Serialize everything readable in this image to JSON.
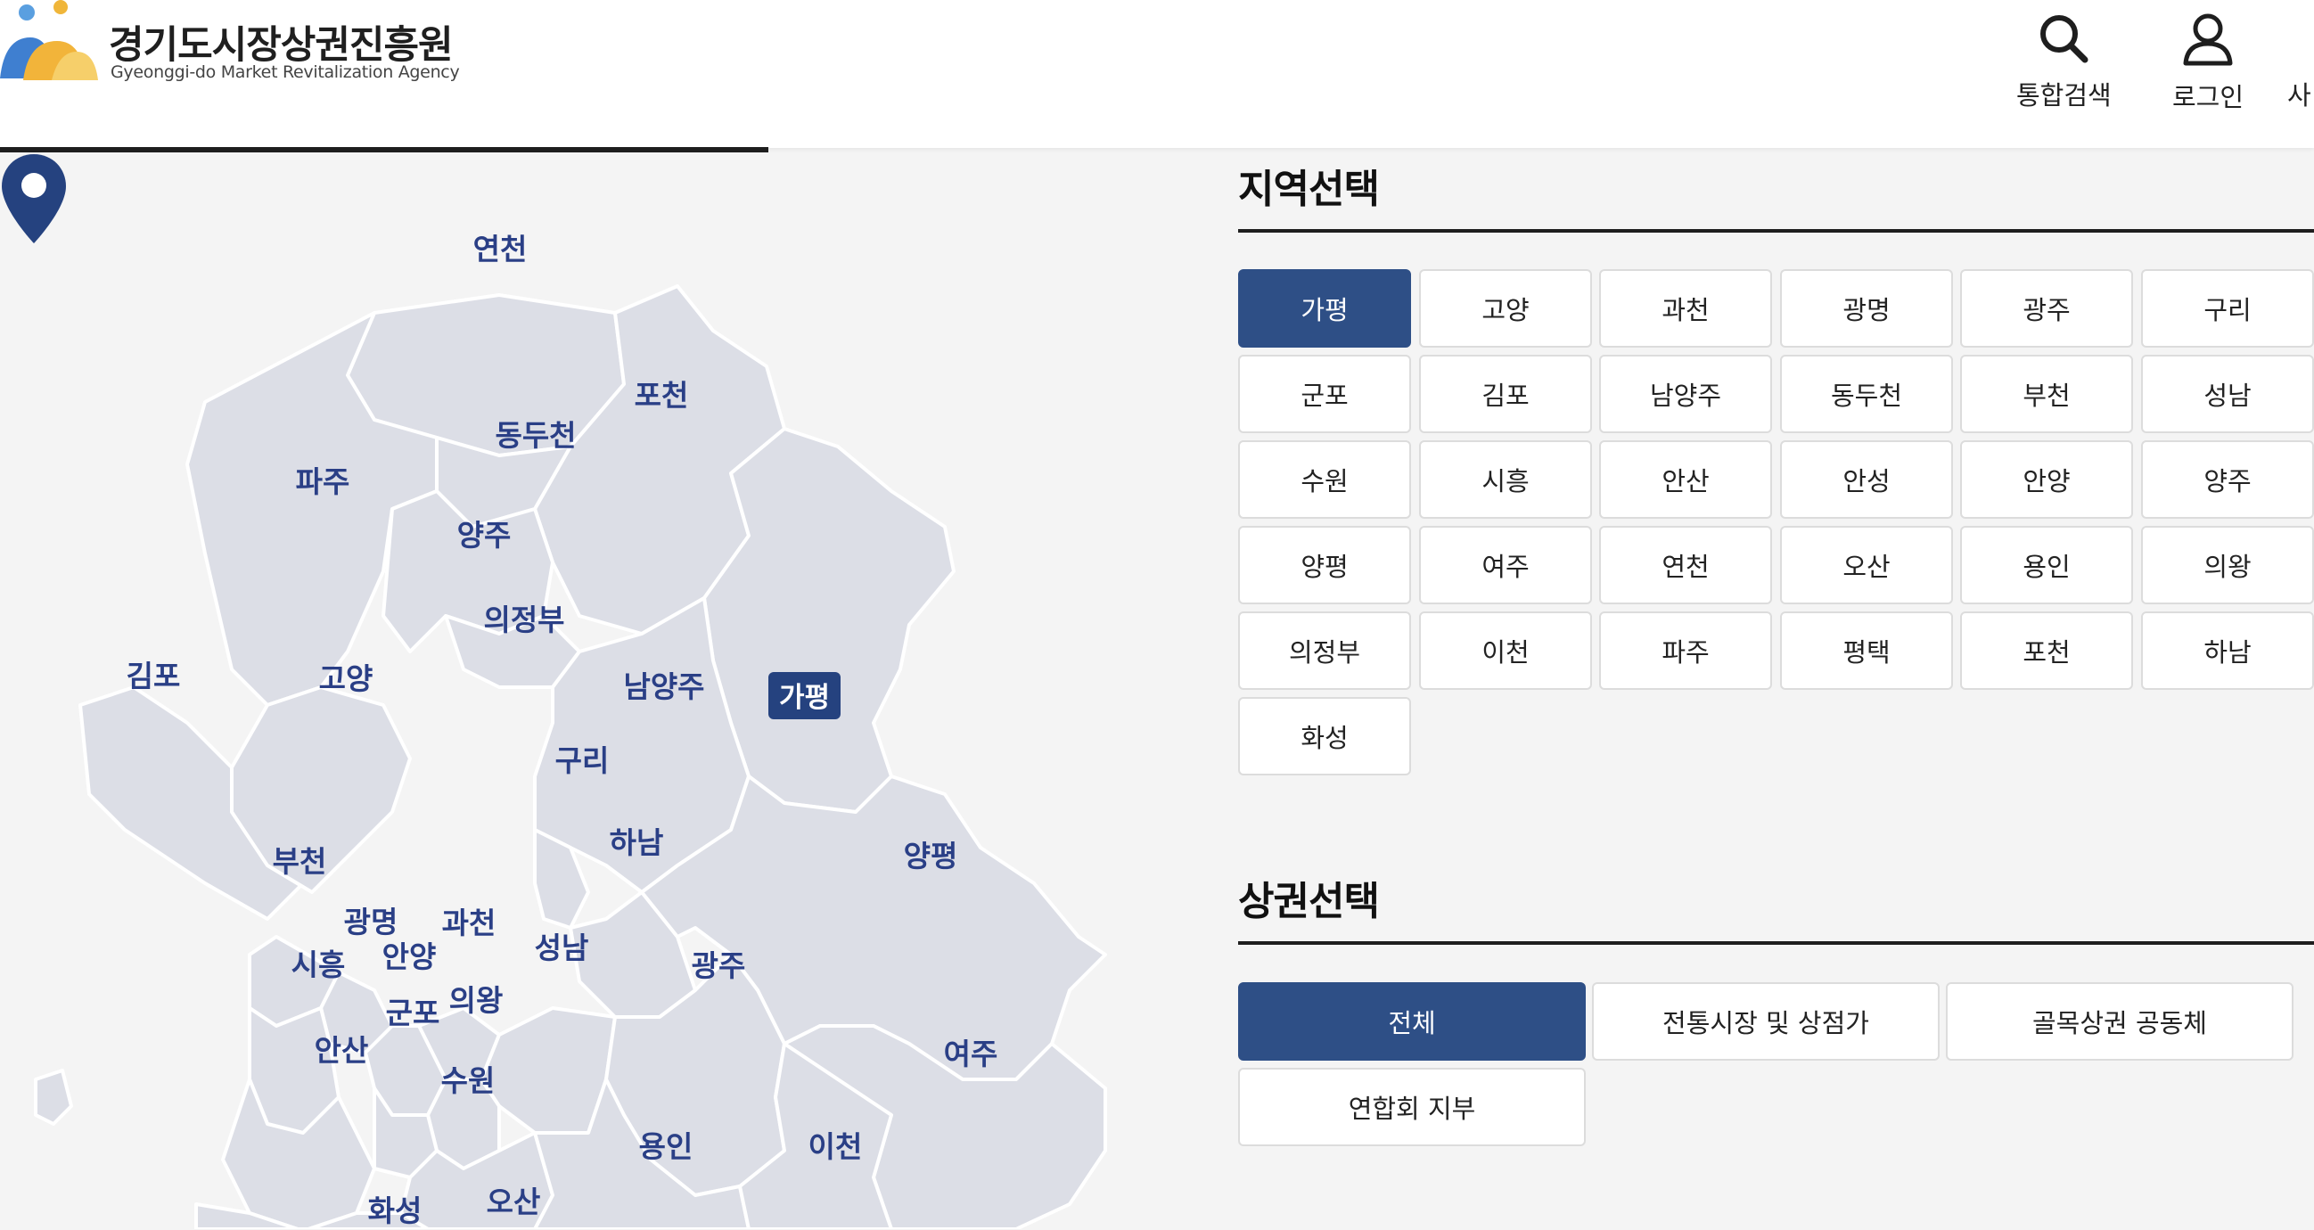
{
  "header": {
    "logo_title": "경기도시장상권진흥원",
    "logo_subtitle": "Gyeonggi-do Market Revitalization Agency",
    "utilities": [
      {
        "label": "통합검색",
        "icon": "search-icon"
      },
      {
        "label": "로그인",
        "icon": "user-icon"
      },
      {
        "label": "사"
      }
    ]
  },
  "map": {
    "selected_region": "가평",
    "labels": [
      "연천",
      "포천",
      "동두천",
      "파주",
      "양주",
      "가평",
      "의정부",
      "김포",
      "고양",
      "남양주",
      "구리",
      "하남",
      "양평",
      "부천",
      "광명",
      "과천",
      "시흥",
      "안양",
      "성남",
      "광주",
      "의왕",
      "군포",
      "안산",
      "수원",
      "여주",
      "용인",
      "이천",
      "화성",
      "오산"
    ]
  },
  "region_select": {
    "title": "지역선택",
    "items": [
      "가평",
      "고양",
      "과천",
      "광명",
      "광주",
      "구리",
      "군포",
      "김포",
      "남양주",
      "동두천",
      "부천",
      "성남",
      "수원",
      "시흥",
      "안산",
      "안성",
      "안양",
      "양주",
      "양평",
      "여주",
      "연천",
      "오산",
      "용인",
      "의왕",
      "의정부",
      "이천",
      "파주",
      "평택",
      "포천",
      "하남",
      "화성"
    ],
    "selected": "가평"
  },
  "district_select": {
    "title": "상권선택",
    "items": [
      "전체",
      "전통시장 및 상점가",
      "골목상권 공동체",
      "연합회 지부"
    ],
    "selected": "전체"
  },
  "colors": {
    "accent": "#2e4f86",
    "map_fill": "#dcdee6",
    "map_label": "#2a3f86",
    "pin": "#25427f"
  }
}
